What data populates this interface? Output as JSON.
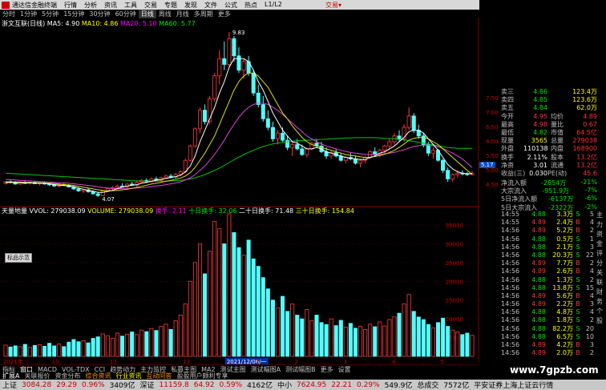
{
  "menu": {
    "app_title": "通达信金融终端",
    "items": [
      "行情",
      "分析",
      "资讯",
      "工具",
      "交易",
      "专题",
      "发现",
      "文件",
      "公式",
      "热点",
      "L1/L2"
    ],
    "broker": "交易▾"
  },
  "periods": {
    "items": [
      "分时",
      "1分钟",
      "5分钟",
      "15分钟",
      "30分钟",
      "60分钟",
      "日线",
      "周线",
      "月线",
      "多周期",
      "更多"
    ],
    "active": 6
  },
  "ma_legend": {
    "name": "浙文互联(日线)",
    "ma5": "MA5: 4.90",
    "ma10": "MA10: 4.86",
    "ma20": "MA20: 5.10",
    "ma60": "MA60: 5.77"
  },
  "price_labels": {
    "high": "9.83",
    "low": "4.07",
    "current": "5.17"
  },
  "price_axis": [
    "7.50",
    "7.00",
    "6.50",
    "6.00",
    "5.50",
    "5.00",
    "4.50"
  ],
  "vol_legend": {
    "name": "天量地量 VVOL: 279038.09",
    "volume": "VOLUME: 279038.09",
    "huanshou": "换手: 2.11",
    "s10": "十日换手: 32.06",
    "s20": "二十日换手: 71.48",
    "s30": "三十日换手: 154.84"
  },
  "vol_axis": [
    "35000",
    "30000",
    "25000",
    "20000",
    "15000",
    "10000",
    "5000"
  ],
  "date_axis": [
    "2021年",
    "10",
    "11",
    "12",
    "2021/12/06/一",
    "1",
    "2",
    "3",
    "4",
    "5"
  ],
  "popup_label": "标品示范",
  "quote": [
    {
      "l": "卖三",
      "p": "4.86",
      "v": "123.4万"
    },
    {
      "l": "卖四",
      "p": "4.85",
      "v": "123.6万"
    },
    {
      "l": "卖五",
      "p": "4.84",
      "v": "62.0万"
    },
    {
      "l": "今开",
      "p": "4.95",
      "l2": "均价",
      "v": "4.89"
    },
    {
      "l": "最高",
      "p": "4.98",
      "l2": "量比",
      "v": "0.67"
    },
    {
      "l": "最低",
      "p": "4.82",
      "l2": "市值",
      "v": "64.5亿"
    },
    {
      "l": "现量",
      "p": "3565",
      "l2": "总量",
      "v": "279038"
    },
    {
      "l": "外盘",
      "p": "110138",
      "l2": "内盘",
      "v": "168900"
    },
    {
      "l": "换手",
      "p": "2.11%",
      "l2": "股本",
      "v": "13.2亿"
    },
    {
      "l": "净资",
      "p": "3.01",
      "l2": "流通",
      "v": "13.2亿"
    },
    {
      "l": "收益(三)",
      "p": "0.030",
      "l2": "PE(动)",
      "v": "45.6"
    }
  ],
  "flows": [
    {
      "l": "净流入额",
      "v": "-2854万",
      "p": "-21%"
    },
    {
      "l": "大宗流入",
      "v": "-951.9万",
      "p": "-7%"
    },
    {
      "l": "5日净流入额",
      "v": "-6137万",
      "p": "-6%"
    },
    {
      "l": "5日大宗流入",
      "v": "-2322万",
      "p": "-2%"
    }
  ],
  "ticks": [
    [
      "14:55",
      "4.88",
      "3.3万",
      "S",
      "5"
    ],
    [
      "14:55",
      "4.89",
      "2.4万",
      "B",
      "4"
    ],
    [
      "14:56",
      "4.89",
      "5.2万",
      "B",
      "2"
    ],
    [
      "14:56",
      "4.88",
      "0.5万",
      "S",
      "1"
    ],
    [
      "14:56",
      "4.88",
      "2.1万",
      "S",
      "3"
    ],
    [
      "14:56",
      "4.88",
      "20.3万",
      "S",
      "22"
    ],
    [
      "14:56",
      "4.89",
      "7.7万",
      "B",
      "2"
    ],
    [
      "14:56",
      "4.89",
      "2.6万",
      "B",
      "4"
    ],
    [
      "14:56",
      "4.88",
      "1.3万",
      "S",
      "2"
    ],
    [
      "14:56",
      "4.88",
      "13.8万",
      "S",
      "15"
    ],
    [
      "14:56",
      "4.89",
      "5.6万",
      "B",
      "4"
    ],
    [
      "14:56",
      "4.89",
      "2.2万",
      "B",
      "3"
    ],
    [
      "14:56",
      "4.88",
      "4.8万",
      "S",
      "4"
    ],
    [
      "14:56",
      "4.88",
      "1.8万",
      "S",
      "2"
    ],
    [
      "14:56",
      "4.88",
      "82.2万",
      "S",
      "20"
    ],
    [
      "14:56",
      "4.88",
      "6.5万",
      "S",
      "10"
    ],
    [
      "14:56",
      "4.89",
      "4.2万",
      "B",
      "3"
    ],
    [
      "14:56",
      "4.89",
      "2.0万",
      "B",
      "2"
    ]
  ],
  "right_tabs": [
    "主",
    "力",
    "资",
    "金",
    "评",
    "分",
    "关",
    "联",
    "财",
    "务",
    "个",
    "股"
  ],
  "bottom_tabs": [
    "指标",
    "窗口",
    "MACD",
    "VOL-TDX",
    "CCI",
    "趋势动力",
    "主力监控",
    "私募主图",
    "MA2",
    "测试主图",
    "测试幅图A",
    "测试幅图B",
    "更多",
    "设置"
  ],
  "bottom_tab_selected": 1,
  "sub_tabs": [
    "扩展A",
    "关联报价",
    "资金分布",
    "综合资讯",
    "行业资讯",
    "互动问答",
    "盈盈用户颇利专享"
  ],
  "status": {
    "sh_label": "上证",
    "sh_val": "3084.28",
    "sh_chg": "29.29",
    "sh_pct": "0.96%",
    "sh_amt": "3409亿",
    "sz_label": "深证",
    "sz_val": "11159.8",
    "sz_chg": "64.92",
    "sz_pct": "0.59%",
    "sz_amt": "4162亿",
    "zx_label": "中小",
    "zx_val": "7624.95",
    "zx_chg": "22.21",
    "zx_pct": "0.29%",
    "zx_amt": "549.9亿",
    "total_label": "总成交",
    "total_amt": "7572亿",
    "server": "平安证券上海上证云行情"
  },
  "watermark": "www.7gpzb.com",
  "chart_data": {
    "type": "candlestick",
    "ylim": [
      3.9,
      10.0
    ],
    "volume_ylim": [
      0,
      38000
    ],
    "candles": [
      [
        4.55,
        4.62,
        4.5,
        4.6
      ],
      [
        4.6,
        4.65,
        4.55,
        4.58
      ],
      [
        4.58,
        4.62,
        4.5,
        4.52
      ],
      [
        4.52,
        4.6,
        4.48,
        4.57
      ],
      [
        4.57,
        4.63,
        4.52,
        4.55
      ],
      [
        4.55,
        4.6,
        4.5,
        4.58
      ],
      [
        4.58,
        4.62,
        4.52,
        4.53
      ],
      [
        4.53,
        4.58,
        4.47,
        4.56
      ],
      [
        4.56,
        4.62,
        4.5,
        4.52
      ],
      [
        4.52,
        4.56,
        4.45,
        4.5
      ],
      [
        4.5,
        4.55,
        4.42,
        4.45
      ],
      [
        4.45,
        4.52,
        4.4,
        4.5
      ],
      [
        4.5,
        4.55,
        4.45,
        4.48
      ],
      [
        4.48,
        4.52,
        4.4,
        4.42
      ],
      [
        4.42,
        4.48,
        4.32,
        4.35
      ],
      [
        4.35,
        4.4,
        4.25,
        4.28
      ],
      [
        4.28,
        4.35,
        4.2,
        4.32
      ],
      [
        4.32,
        4.38,
        4.22,
        4.25
      ],
      [
        4.25,
        4.3,
        4.15,
        4.18
      ],
      [
        4.18,
        4.25,
        4.07,
        4.12
      ],
      [
        4.12,
        4.3,
        4.1,
        4.28
      ],
      [
        4.28,
        4.4,
        4.25,
        4.36
      ],
      [
        4.36,
        4.45,
        4.3,
        4.4
      ],
      [
        4.4,
        4.5,
        4.35,
        4.45
      ],
      [
        4.45,
        4.55,
        4.4,
        4.42
      ],
      [
        4.42,
        4.55,
        4.38,
        4.52
      ],
      [
        4.52,
        4.6,
        4.45,
        4.48
      ],
      [
        4.48,
        4.62,
        4.42,
        4.58
      ],
      [
        4.58,
        4.7,
        4.55,
        4.65
      ],
      [
        4.65,
        4.72,
        4.55,
        4.6
      ],
      [
        4.6,
        4.75,
        4.58,
        4.7
      ],
      [
        4.7,
        4.78,
        4.62,
        4.66
      ],
      [
        4.66,
        4.78,
        4.6,
        4.74
      ],
      [
        4.74,
        4.85,
        4.7,
        4.8
      ],
      [
        4.8,
        4.88,
        4.72,
        4.76
      ],
      [
        4.76,
        4.9,
        4.72,
        4.86
      ],
      [
        4.86,
        5.0,
        4.8,
        4.95
      ],
      [
        4.95,
        5.4,
        4.9,
        5.35
      ],
      [
        5.35,
        5.9,
        5.3,
        5.85
      ],
      [
        5.85,
        6.5,
        5.8,
        6.45
      ],
      [
        6.45,
        7.2,
        6.3,
        7.1
      ],
      [
        7.1,
        7.3,
        6.6,
        6.7
      ],
      [
        6.7,
        7.6,
        6.6,
        7.5
      ],
      [
        7.5,
        8.4,
        7.4,
        8.3
      ],
      [
        8.3,
        9.2,
        8.0,
        8.9
      ],
      [
        8.9,
        9.5,
        8.5,
        8.7
      ],
      [
        8.7,
        9.83,
        8.6,
        9.6
      ],
      [
        9.6,
        9.7,
        8.8,
        9.0
      ],
      [
        9.0,
        9.3,
        8.4,
        8.5
      ],
      [
        8.5,
        8.9,
        8.2,
        8.8
      ],
      [
        8.8,
        9.0,
        8.3,
        8.4
      ],
      [
        8.4,
        8.5,
        7.6,
        7.7
      ],
      [
        7.7,
        8.0,
        7.2,
        7.3
      ],
      [
        7.3,
        7.6,
        6.7,
        6.8
      ],
      [
        6.8,
        7.1,
        6.4,
        6.5
      ],
      [
        6.5,
        6.7,
        6.0,
        6.1
      ],
      [
        6.1,
        6.4,
        5.9,
        6.3
      ],
      [
        6.3,
        6.5,
        6.0,
        6.05
      ],
      [
        6.05,
        6.2,
        5.7,
        5.8
      ],
      [
        5.8,
        6.0,
        5.5,
        5.9
      ],
      [
        5.9,
        6.1,
        5.7,
        5.75
      ],
      [
        5.75,
        5.9,
        5.5,
        5.55
      ],
      [
        5.55,
        5.8,
        5.45,
        5.75
      ],
      [
        5.75,
        6.0,
        5.7,
        5.95
      ],
      [
        5.95,
        6.1,
        5.8,
        5.85
      ],
      [
        5.85,
        6.0,
        5.6,
        5.65
      ],
      [
        5.65,
        5.8,
        5.4,
        5.5
      ],
      [
        5.5,
        5.7,
        5.4,
        5.62
      ],
      [
        5.62,
        5.75,
        5.45,
        5.5
      ],
      [
        5.5,
        5.6,
        5.3,
        5.35
      ],
      [
        5.35,
        5.5,
        5.25,
        5.45
      ],
      [
        5.45,
        5.6,
        5.35,
        5.4
      ],
      [
        5.4,
        5.5,
        5.2,
        5.25
      ],
      [
        5.25,
        5.4,
        5.1,
        5.35
      ],
      [
        5.35,
        5.5,
        5.25,
        5.45
      ],
      [
        5.45,
        5.7,
        5.4,
        5.65
      ],
      [
        5.65,
        5.8,
        5.5,
        5.55
      ],
      [
        5.55,
        5.75,
        5.45,
        5.7
      ],
      [
        5.7,
        5.9,
        5.6,
        5.85
      ],
      [
        5.85,
        6.1,
        5.75,
        6.0
      ],
      [
        6.0,
        6.3,
        5.9,
        6.2
      ],
      [
        6.2,
        6.4,
        6.0,
        6.1
      ],
      [
        6.1,
        6.6,
        6.0,
        6.5
      ],
      [
        6.5,
        7.2,
        6.4,
        6.9
      ],
      [
        6.9,
        7.0,
        6.3,
        6.4
      ],
      [
        6.4,
        6.6,
        6.1,
        6.2
      ],
      [
        6.2,
        6.3,
        5.8,
        5.9
      ],
      [
        5.9,
        6.0,
        5.5,
        5.6
      ],
      [
        5.6,
        5.8,
        5.4,
        5.7
      ],
      [
        5.7,
        5.75,
        5.3,
        5.35
      ],
      [
        5.35,
        5.4,
        4.9,
        5.0
      ],
      [
        5.0,
        5.1,
        4.6,
        4.7
      ],
      [
        4.7,
        4.9,
        4.6,
        4.85
      ],
      [
        4.85,
        5.0,
        4.75,
        4.9
      ],
      [
        4.9,
        5.0,
        4.82,
        4.88
      ],
      [
        4.88,
        4.95,
        4.8,
        4.85
      ],
      [
        4.85,
        4.98,
        4.82,
        4.89
      ]
    ],
    "ma5": [
      4.57,
      4.58,
      4.57,
      4.57,
      4.56,
      4.56,
      4.56,
      4.55,
      4.55,
      4.53,
      4.5,
      4.48,
      4.47,
      4.45,
      4.42,
      4.38,
      4.34,
      4.3,
      4.27,
      4.23,
      4.23,
      4.26,
      4.3,
      4.36,
      4.41,
      4.45,
      4.48,
      4.5,
      4.55,
      4.58,
      4.62,
      4.65,
      4.68,
      4.72,
      4.75,
      4.78,
      4.83,
      4.95,
      5.15,
      5.5,
      6.0,
      6.4,
      6.8,
      7.2,
      7.7,
      8.1,
      8.6,
      8.9,
      8.9,
      8.9,
      8.8,
      8.5,
      8.1,
      7.8,
      7.4,
      7.0,
      6.7,
      6.4,
      6.2,
      6.0,
      5.95,
      5.85,
      5.75,
      5.75,
      5.8,
      5.75,
      5.65,
      5.6,
      5.55,
      5.5,
      5.45,
      5.42,
      5.4,
      5.38,
      5.38,
      5.45,
      5.5,
      5.6,
      5.65,
      5.75,
      5.85,
      6.0,
      6.15,
      6.35,
      6.4,
      6.4,
      6.3,
      6.1,
      5.9,
      5.7,
      5.45,
      5.2,
      5.05,
      4.95,
      4.9,
      4.88,
      4.89
    ],
    "ma10": [
      4.6,
      4.6,
      4.59,
      4.59,
      4.58,
      4.58,
      4.57,
      4.57,
      4.56,
      4.55,
      4.54,
      4.52,
      4.5,
      4.49,
      4.47,
      4.44,
      4.41,
      4.38,
      4.35,
      4.32,
      4.3,
      4.29,
      4.29,
      4.3,
      4.32,
      4.34,
      4.37,
      4.4,
      4.44,
      4.48,
      4.52,
      4.55,
      4.58,
      4.62,
      4.65,
      4.69,
      4.73,
      4.8,
      4.92,
      5.1,
      5.35,
      5.6,
      5.9,
      6.2,
      6.6,
      7.0,
      7.4,
      7.8,
      8.1,
      8.3,
      8.4,
      8.4,
      8.3,
      8.1,
      7.9,
      7.6,
      7.3,
      7.0,
      6.8,
      6.55,
      6.35,
      6.15,
      6.0,
      5.9,
      5.85,
      5.8,
      5.75,
      5.7,
      5.65,
      5.6,
      5.55,
      5.52,
      5.5,
      5.47,
      5.45,
      5.46,
      5.48,
      5.52,
      5.56,
      5.62,
      5.7,
      5.8,
      5.92,
      6.05,
      6.12,
      6.15,
      6.15,
      6.1,
      6.0,
      5.9,
      5.75,
      5.6,
      5.45,
      5.3,
      5.15,
      5.0,
      4.86
    ],
    "ma20": [
      4.68,
      4.67,
      4.66,
      4.65,
      4.64,
      4.63,
      4.62,
      4.61,
      4.6,
      4.59,
      4.58,
      4.57,
      4.56,
      4.55,
      4.53,
      4.51,
      4.49,
      4.47,
      4.45,
      4.42,
      4.4,
      4.38,
      4.37,
      4.36,
      4.36,
      4.36,
      4.37,
      4.38,
      4.39,
      4.41,
      4.43,
      4.45,
      4.47,
      4.5,
      4.53,
      4.56,
      4.6,
      4.66,
      4.74,
      4.85,
      5.0,
      5.15,
      5.35,
      5.55,
      5.8,
      6.05,
      6.35,
      6.6,
      6.85,
      7.05,
      7.2,
      7.3,
      7.35,
      7.35,
      7.3,
      7.2,
      7.1,
      6.95,
      6.8,
      6.65,
      6.5,
      6.35,
      6.2,
      6.1,
      6.0,
      5.92,
      5.85,
      5.8,
      5.75,
      5.7,
      5.66,
      5.62,
      5.6,
      5.58,
      5.56,
      5.55,
      5.55,
      5.56,
      5.58,
      5.6,
      5.63,
      5.67,
      5.72,
      5.78,
      5.83,
      5.86,
      5.88,
      5.88,
      5.86,
      5.82,
      5.76,
      5.68,
      5.6,
      5.5,
      5.4,
      5.25,
      5.1
    ],
    "ma60": [
      4.9,
      4.89,
      4.88,
      4.87,
      4.86,
      4.85,
      4.84,
      4.83,
      4.82,
      4.81,
      4.8,
      4.79,
      4.78,
      4.77,
      4.76,
      4.75,
      4.74,
      4.73,
      4.72,
      4.71,
      4.7,
      4.69,
      4.68,
      4.67,
      4.66,
      4.65,
      4.64,
      4.63,
      4.62,
      4.62,
      4.62,
      4.62,
      4.62,
      4.62,
      4.63,
      4.64,
      4.65,
      4.67,
      4.7,
      4.74,
      4.79,
      4.85,
      4.92,
      5.0,
      5.08,
      5.17,
      5.27,
      5.37,
      5.46,
      5.55,
      5.63,
      5.7,
      5.77,
      5.83,
      5.88,
      5.92,
      5.95,
      5.98,
      6.0,
      6.02,
      6.03,
      6.04,
      6.05,
      6.06,
      6.07,
      6.08,
      6.09,
      6.1,
      6.11,
      6.12,
      6.13,
      6.13,
      6.14,
      6.14,
      6.14,
      6.14,
      6.14,
      6.13,
      6.12,
      6.11,
      6.1,
      6.08,
      6.06,
      6.04,
      6.01,
      5.98,
      5.95,
      5.92,
      5.89,
      5.86,
      5.83,
      5.8,
      5.78,
      5.77,
      5.77,
      5.77,
      5.77
    ],
    "volume": [
      3000,
      2500,
      2800,
      2600,
      3200,
      2400,
      2900,
      3100,
      2700,
      3500,
      2800,
      3300,
      2600,
      3800,
      4500,
      3900,
      4200,
      3600,
      4800,
      5200,
      6000,
      5500,
      4800,
      6200,
      5400,
      5900,
      6500,
      5800,
      7000,
      6600,
      7400,
      6900,
      8000,
      8600,
      7200,
      9500,
      11000,
      14000,
      20000,
      25000,
      30000,
      22000,
      28000,
      36000,
      34000,
      30000,
      38000,
      33000,
      29000,
      27000,
      31000,
      26000,
      24000,
      21000,
      18000,
      15000,
      13000,
      16000,
      12000,
      14000,
      11000,
      10000,
      12500,
      9500,
      11000,
      9000,
      8500,
      10000,
      8200,
      9600,
      7800,
      8800,
      7500,
      8000,
      7200,
      8600,
      7900,
      9200,
      8100,
      9800,
      10500,
      11500,
      14000,
      16500,
      12000,
      10500,
      9800,
      8500,
      7600,
      9000,
      10200,
      8000,
      7000,
      6500,
      5800,
      6200,
      5600
    ],
    "volume_up": [
      1,
      0,
      0,
      1,
      0,
      1,
      0,
      1,
      0,
      0,
      0,
      1,
      0,
      0,
      0,
      0,
      1,
      0,
      0,
      0,
      1,
      1,
      1,
      1,
      0,
      1,
      0,
      1,
      1,
      0,
      1,
      0,
      1,
      1,
      0,
      1,
      1,
      1,
      1,
      1,
      1,
      0,
      1,
      1,
      1,
      0,
      1,
      0,
      0,
      1,
      0,
      0,
      0,
      0,
      0,
      0,
      1,
      0,
      0,
      1,
      0,
      0,
      1,
      1,
      0,
      0,
      0,
      1,
      0,
      0,
      1,
      0,
      0,
      1,
      1,
      1,
      0,
      1,
      1,
      1,
      1,
      0,
      1,
      1,
      0,
      0,
      0,
      0,
      1,
      0,
      0,
      0,
      1,
      1,
      0,
      0,
      1
    ]
  }
}
